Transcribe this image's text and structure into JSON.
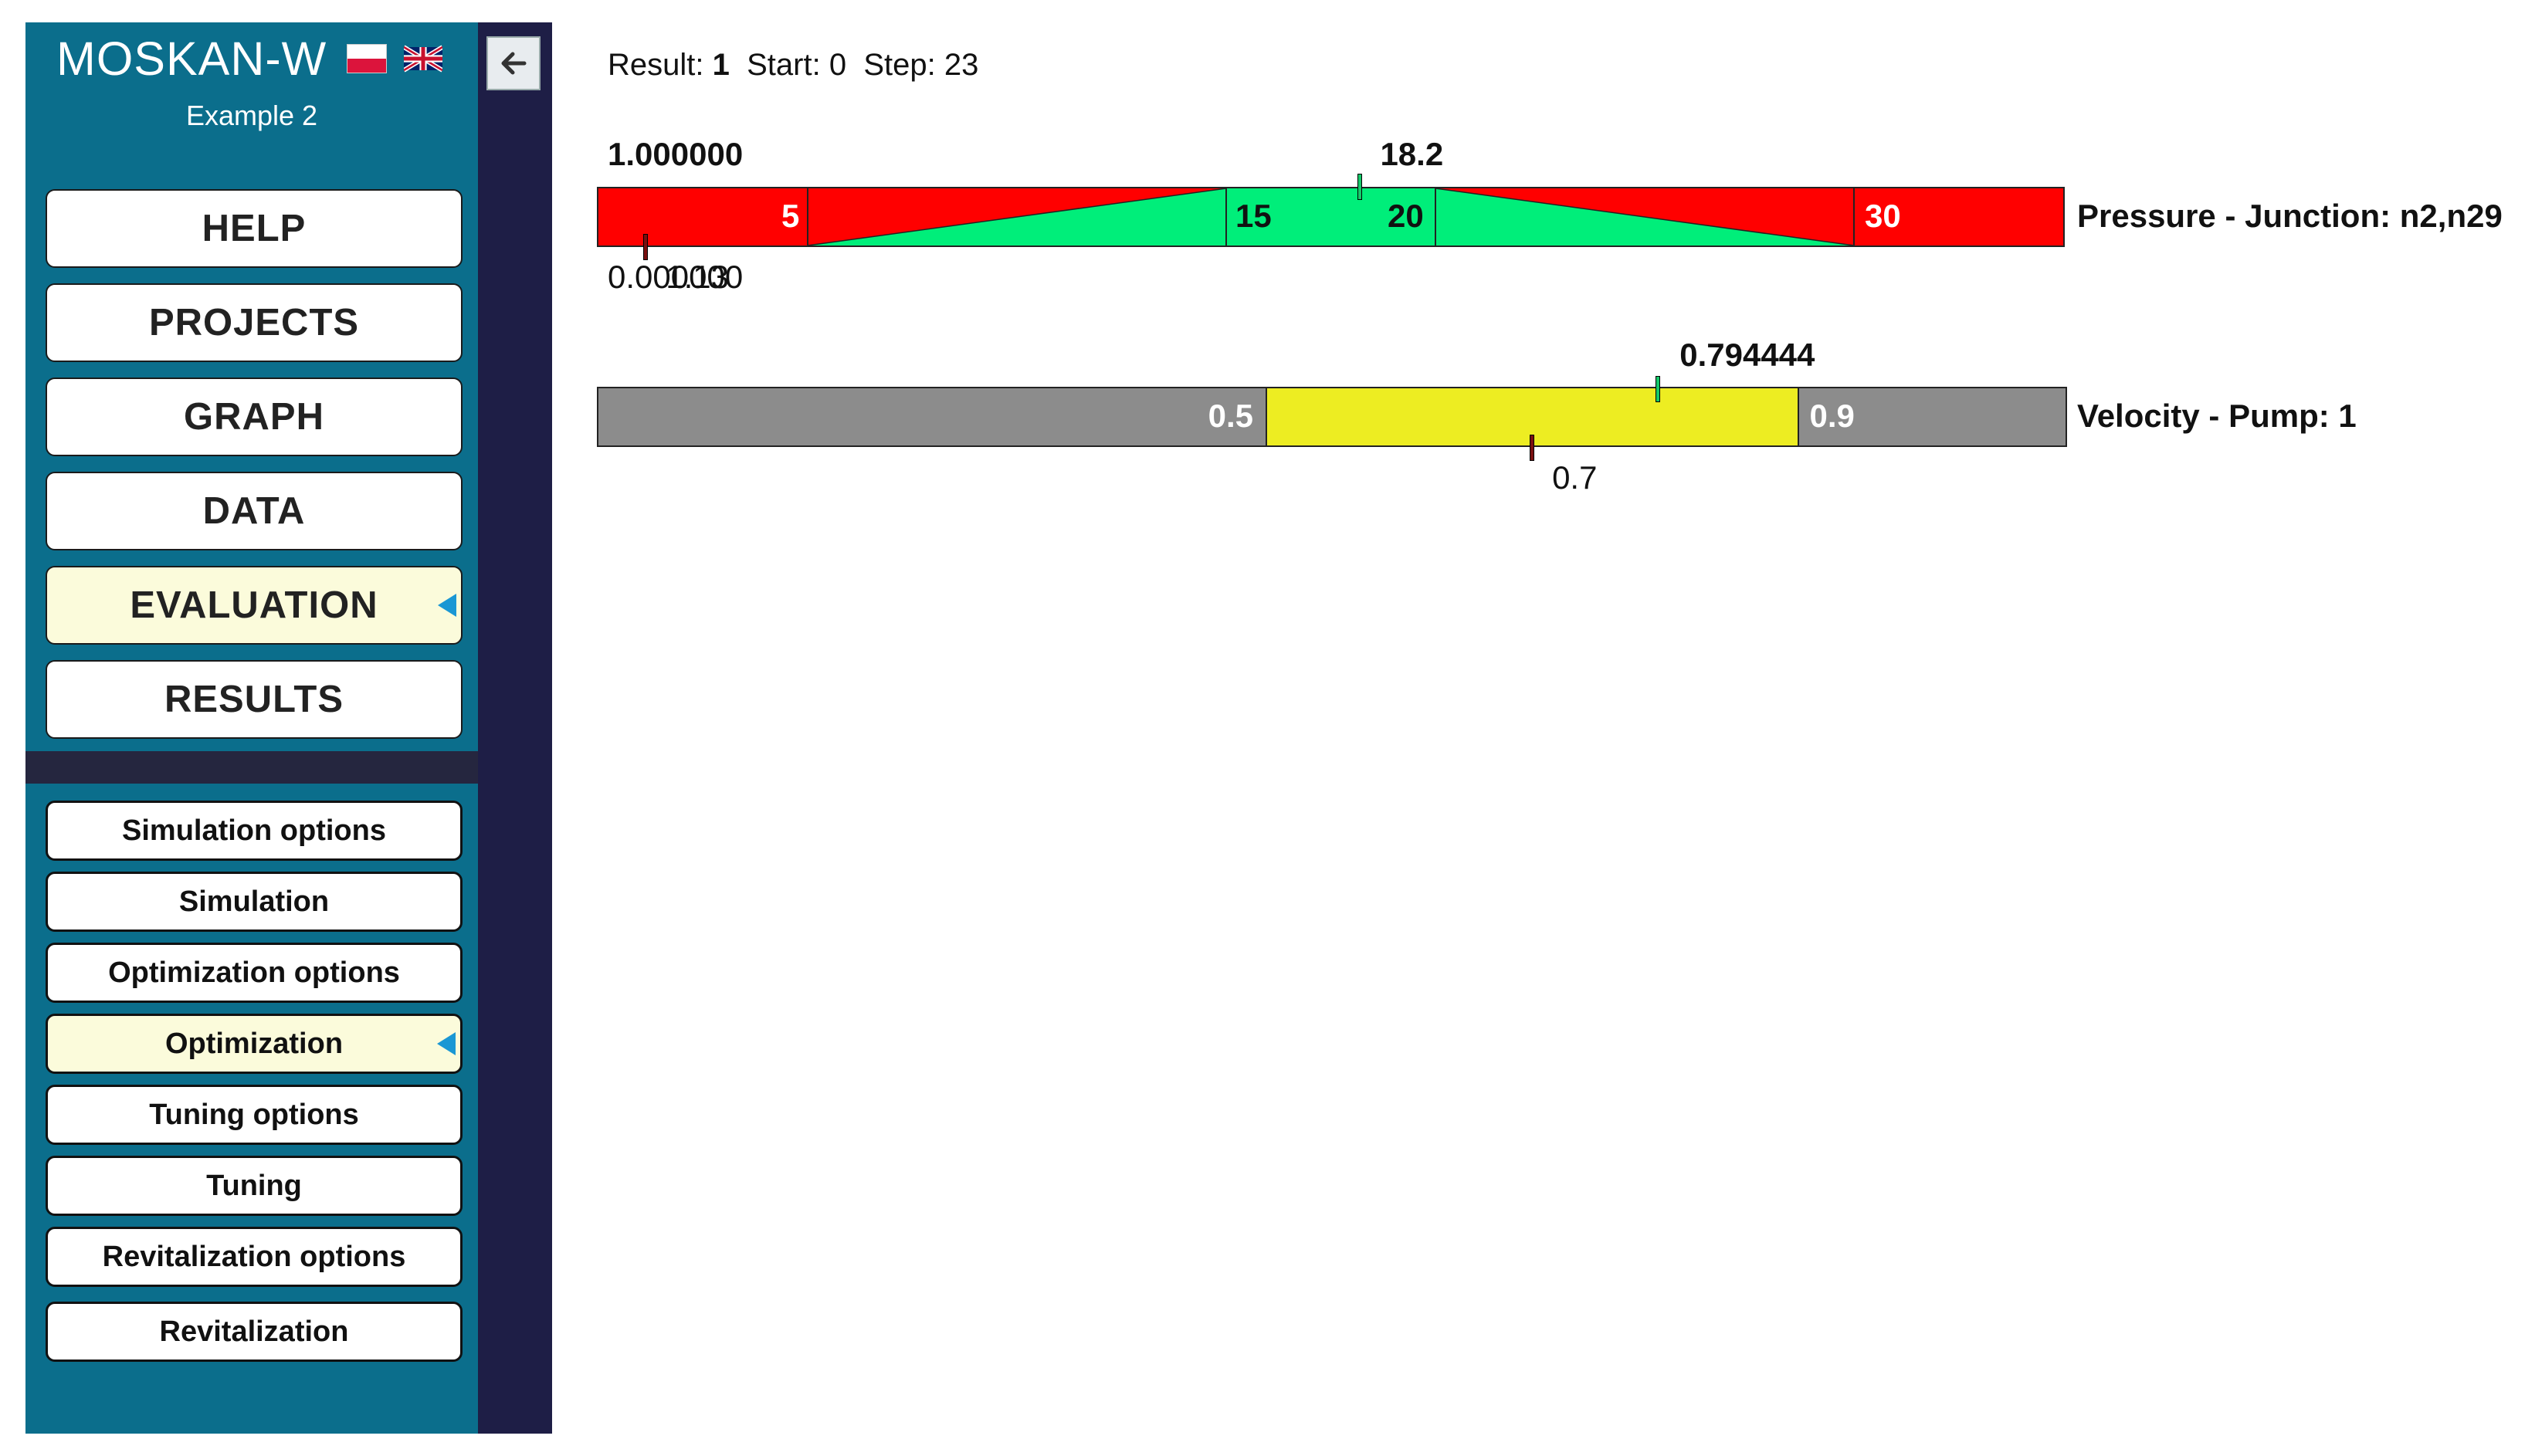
{
  "app": {
    "title": "MOSKAN-W",
    "subtitle": "Example 2",
    "languages": [
      "Polish",
      "English"
    ]
  },
  "menu": {
    "main": [
      {
        "label": "HELP",
        "active": false
      },
      {
        "label": "PROJECTS",
        "active": false
      },
      {
        "label": "GRAPH",
        "active": false
      },
      {
        "label": "DATA",
        "active": false
      },
      {
        "label": "EVALUATION",
        "active": true
      },
      {
        "label": "RESULTS",
        "active": false
      }
    ],
    "sub": [
      {
        "label": "Simulation options",
        "active": false
      },
      {
        "label": "Simulation",
        "active": false
      },
      {
        "label": "Optimization options",
        "active": false
      },
      {
        "label": "Optimization",
        "active": true
      },
      {
        "label": "Tuning options",
        "active": false
      },
      {
        "label": "Tuning",
        "active": false
      },
      {
        "label": "Revitalization options",
        "active": false
      },
      {
        "label": "Revitalization",
        "active": false
      }
    ]
  },
  "status": {
    "result_label": "Result:",
    "result_value": "1",
    "start_label": "Start:",
    "start_value": "0",
    "step_label": "Step:",
    "step_value": "23"
  },
  "gauges": [
    {
      "name": "Pressure - Junction: n2,n29",
      "range": [
        0,
        35
      ],
      "thresholds": [
        "5",
        "15",
        "20",
        "30"
      ],
      "threshold_values": [
        5,
        15,
        20,
        30
      ],
      "current_value": "18.2",
      "current": 18.2,
      "reference_value": "1.13",
      "reference": 1.13,
      "score_top": "1.000000",
      "score_bottom": "0.000000",
      "colors": {
        "bad": "#ff0000",
        "good": "#00ee7a"
      }
    },
    {
      "name": "Velocity - Pump: 1",
      "range": [
        0,
        1.1
      ],
      "thresholds": [
        "0.5",
        "0.9"
      ],
      "threshold_values": [
        0.5,
        0.9
      ],
      "current_value": "0.794444",
      "current": 0.794444,
      "reference_value": "0.7",
      "reference": 0.7,
      "colors": {
        "out": "#8c8c8c",
        "in": "#eded22"
      }
    }
  ]
}
